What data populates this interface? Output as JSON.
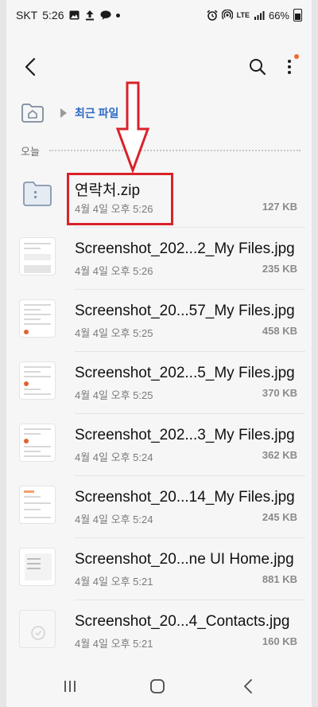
{
  "status_bar": {
    "carrier": "SKT",
    "time": "5:26",
    "network": "LTE",
    "battery": "66%"
  },
  "app_bar": {
    "back_icon": "chevron-left-icon",
    "search_icon": "search-icon",
    "more_icon": "more-vertical-icon",
    "badge_color": "#f06a2e"
  },
  "breadcrumb": {
    "current": "최근 파일"
  },
  "section": {
    "label": "오늘"
  },
  "files": [
    {
      "name": "연락처.zip",
      "date": "4월 4일 오후 5:26",
      "size": "127 KB",
      "thumb": "folder"
    },
    {
      "name": "Screenshot_202...2_My Files.jpg",
      "date": "4월 4일 오후 5:26",
      "size": "235 KB",
      "thumb": "screenshot-a"
    },
    {
      "name": "Screenshot_20...57_My Files.jpg",
      "date": "4월 4일 오후 5:25",
      "size": "458 KB",
      "thumb": "screenshot-b"
    },
    {
      "name": "Screenshot_202...5_My Files.jpg",
      "date": "4월 4일 오후 5:25",
      "size": "370 KB",
      "thumb": "screenshot-c"
    },
    {
      "name": "Screenshot_202...3_My Files.jpg",
      "date": "4월 4일 오후 5:24",
      "size": "362 KB",
      "thumb": "screenshot-d"
    },
    {
      "name": "Screenshot_20...14_My Files.jpg",
      "date": "4월 4일 오후 5:24",
      "size": "245 KB",
      "thumb": "screenshot-e"
    },
    {
      "name": "Screenshot_20...ne UI Home.jpg",
      "date": "4월 4일 오후 5:21",
      "size": "881 KB",
      "thumb": "screenshot-dark"
    },
    {
      "name": "Screenshot_20...4_Contacts.jpg",
      "date": "4월 4일 오후 5:21",
      "size": "160 KB",
      "thumb": "screenshot-contacts"
    }
  ],
  "annotation": {
    "color": "#d9222a"
  }
}
